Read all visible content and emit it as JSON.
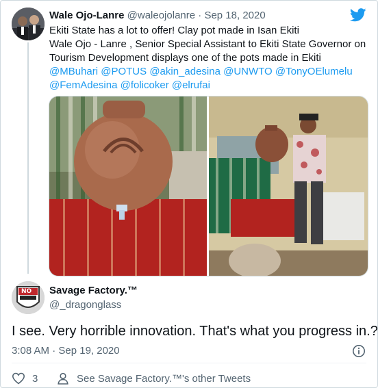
{
  "tweet": {
    "author_name": "Wale Ojo-Lanre",
    "author_handle": "@waleojolanre",
    "separator": "·",
    "date": "Sep 18, 2020",
    "text_lines": [
      "Ekiti State has a lot to offer! Clay pot made in Isan Ekiti",
      "Wale Ojo - Lanre , Senior Special Assistant to Ekiti State Governor on",
      "Tourism Development displays one of the pots made in Ekiti"
    ],
    "mentions_line1": "@MBuhari @POTUS @akin_adesina @UNWTO @TonyOElumelu",
    "mentions_line2": "@FemAdesina @folicoker @elrufai"
  },
  "reply": {
    "author_name": "Savage Factory.™",
    "author_handle": "@_dragonglass",
    "avatar_text": "NO",
    "text": "I see. Very horrible innovation. That's what you progress in.?",
    "timestamp": "3:08 AM · Sep 19, 2020",
    "like_count": "3",
    "other_tweets_label": "See Savage Factory.™'s other Tweets"
  },
  "colors": {
    "accent": "#1d9bf0",
    "text": "#0f1419",
    "muted": "#536471",
    "border": "#cfd9de"
  },
  "icons": {
    "brand": "twitter-bird-icon",
    "info": "info-icon",
    "like": "heart-icon",
    "profile": "person-icon"
  }
}
